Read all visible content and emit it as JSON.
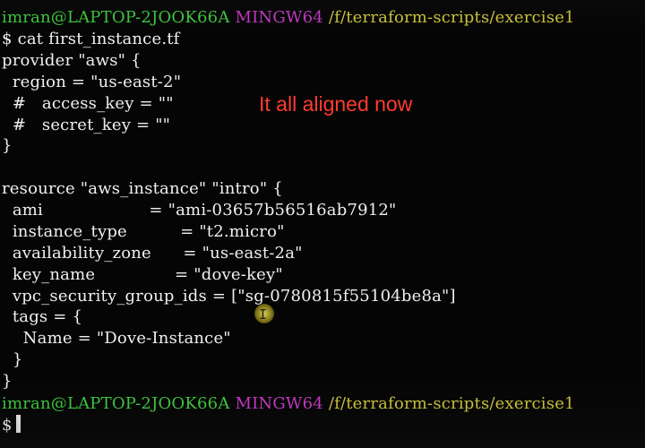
{
  "terminal": {
    "prompt1": {
      "user_host": "imran@LAPTOP-2JOOK66A",
      "system": "MINGW64",
      "path": "/f/terraform-scripts/exercise1"
    },
    "command": "$ cat first_instance.tf",
    "lines": [
      "provider \"aws\" {",
      "  region = \"us-east-2\"",
      "  #   access_key = \"\"",
      "  #   secret_key = \"\"",
      "}",
      "",
      "resource \"aws_instance\" \"intro\" {",
      "  ami                    = \"ami-03657b56516ab7912\"",
      "  instance_type          = \"t2.micro\"",
      "  availability_zone      = \"us-east-2a\"",
      "  key_name               = \"dove-key\"",
      "  vpc_security_group_ids = [\"sg-0780815f55104be8a\"]",
      "  tags = {",
      "    Name = \"Dove-Instance\"",
      "  }",
      "}"
    ],
    "prompt2": {
      "user_host": "imran@LAPTOP-2JOOK66A",
      "system": "MINGW64",
      "path": "/f/terraform-scripts/exercise1"
    },
    "input_prompt": "$"
  },
  "annotation": {
    "text": "It all aligned now",
    "color": "#ff3b2e"
  },
  "colors": {
    "background": "#050505",
    "user_host": "#3fce3f",
    "system": "#c93bc9",
    "path": "#d2c93d",
    "text": "#f0f0f0"
  }
}
